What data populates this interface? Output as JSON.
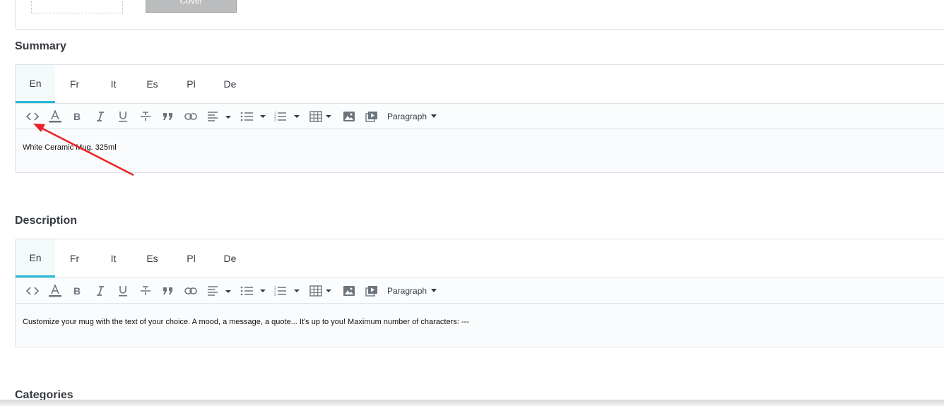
{
  "top": {
    "cover_label": "Cover"
  },
  "summary": {
    "title": "Summary",
    "tabs": [
      "En",
      "Fr",
      "It",
      "Es",
      "Pl",
      "De"
    ],
    "format": "Paragraph",
    "content": "White Ceramic Mug. 325ml"
  },
  "description": {
    "title": "Description",
    "tabs": [
      "En",
      "Fr",
      "It",
      "Es",
      "Pl",
      "De"
    ],
    "format": "Paragraph",
    "content": "Customize your mug with the text of your choice. A mood, a message, a quote... It's up to you! Maximum number of characters: ---"
  },
  "categories": {
    "title": "Categories"
  },
  "colors": {
    "accent": "#25b9d7",
    "annotation_arrow": "#e8242a"
  }
}
